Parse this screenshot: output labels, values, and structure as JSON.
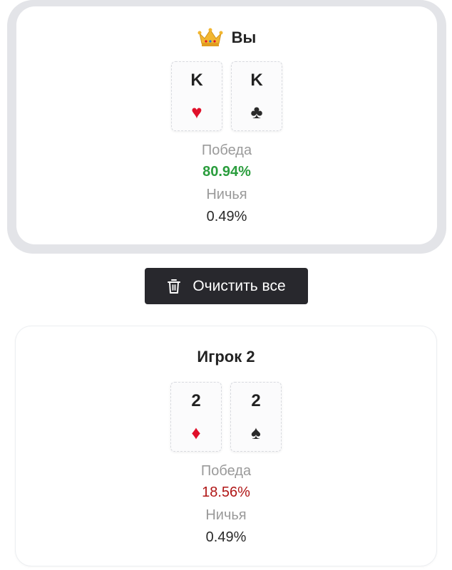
{
  "players": [
    {
      "name": "Вы",
      "crown_icon": "crown-icon",
      "cards": [
        {
          "rank": "K",
          "suit": "♥",
          "suit_name": "hearts",
          "color": "red"
        },
        {
          "rank": "K",
          "suit": "♣",
          "suit_name": "clubs",
          "color": "black"
        }
      ],
      "win_label": "Победа",
      "win_value": "80.94%",
      "win_color": "#2a9d3d",
      "tie_label": "Ничья",
      "tie_value": "0.49%"
    },
    {
      "name": "Игрок 2",
      "cards": [
        {
          "rank": "2",
          "suit": "♦",
          "suit_name": "diamonds",
          "color": "red"
        },
        {
          "rank": "2",
          "suit": "♠",
          "suit_name": "spades",
          "color": "black"
        }
      ],
      "win_label": "Победа",
      "win_value": "18.56%",
      "win_color": "#b01616",
      "tie_label": "Ничья",
      "tie_value": "0.49%"
    }
  ],
  "clear_button": {
    "label": "Очистить все",
    "icon": "trash-icon"
  }
}
